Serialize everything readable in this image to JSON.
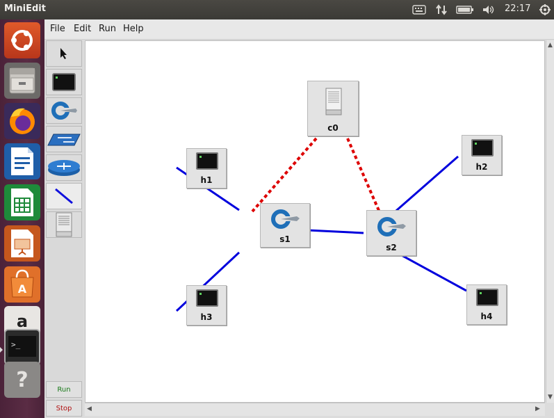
{
  "app": {
    "title": "MiniEdit"
  },
  "top_panel": {
    "clock": "22:17",
    "tray_icons": [
      "keyboard-icon",
      "network-icon",
      "battery-icon",
      "volume-icon",
      "settings-gear-icon"
    ]
  },
  "launcher": {
    "items": [
      "ubuntu-dash",
      "files",
      "firefox",
      "libreoffice-writer",
      "libreoffice-calc",
      "libreoffice-impress",
      "ubuntu-software",
      "amazon",
      "terminal",
      "help"
    ]
  },
  "menubar": {
    "items": [
      "File",
      "Edit",
      "Run",
      "Help"
    ]
  },
  "toolbox": {
    "tools": [
      "select-tool",
      "host-tool",
      "switch-tool",
      "legacy-switch-tool",
      "router-tool",
      "link-tool",
      "controller-tool"
    ],
    "run_label": "Run",
    "stop_label": "Stop"
  },
  "topology": {
    "controllers": [
      {
        "label": "c0"
      }
    ],
    "switches": [
      {
        "label": "s1"
      },
      {
        "label": "s2"
      }
    ],
    "hosts": [
      {
        "label": "h1"
      },
      {
        "label": "h2"
      },
      {
        "label": "h3"
      },
      {
        "label": "h4"
      }
    ],
    "links": [
      {
        "from": "h1",
        "to": "s1",
        "type": "data"
      },
      {
        "from": "h3",
        "to": "s1",
        "type": "data"
      },
      {
        "from": "s1",
        "to": "s2",
        "type": "data"
      },
      {
        "from": "s2",
        "to": "h2",
        "type": "data"
      },
      {
        "from": "s2",
        "to": "h4",
        "type": "data"
      },
      {
        "from": "c0",
        "to": "s1",
        "type": "control"
      },
      {
        "from": "c0",
        "to": "s2",
        "type": "control"
      }
    ]
  },
  "colors": {
    "data_link": "#0000dd",
    "control_link": "#dd0000",
    "launcher_bg": "#5a2c44"
  }
}
